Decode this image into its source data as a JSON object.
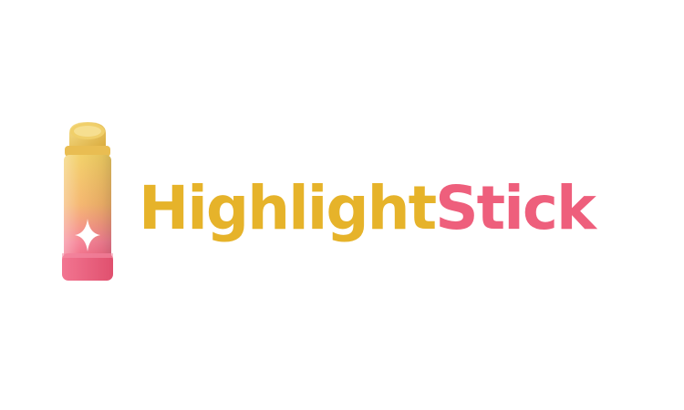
{
  "brand": {
    "word_primary": "Highlight",
    "word_secondary": "Stick",
    "colors": {
      "gold": "#e6b32a",
      "pink": "#ee5f7c",
      "background": "#ffffff"
    },
    "icon": "highlighter-stick-with-sparkle-icon"
  }
}
